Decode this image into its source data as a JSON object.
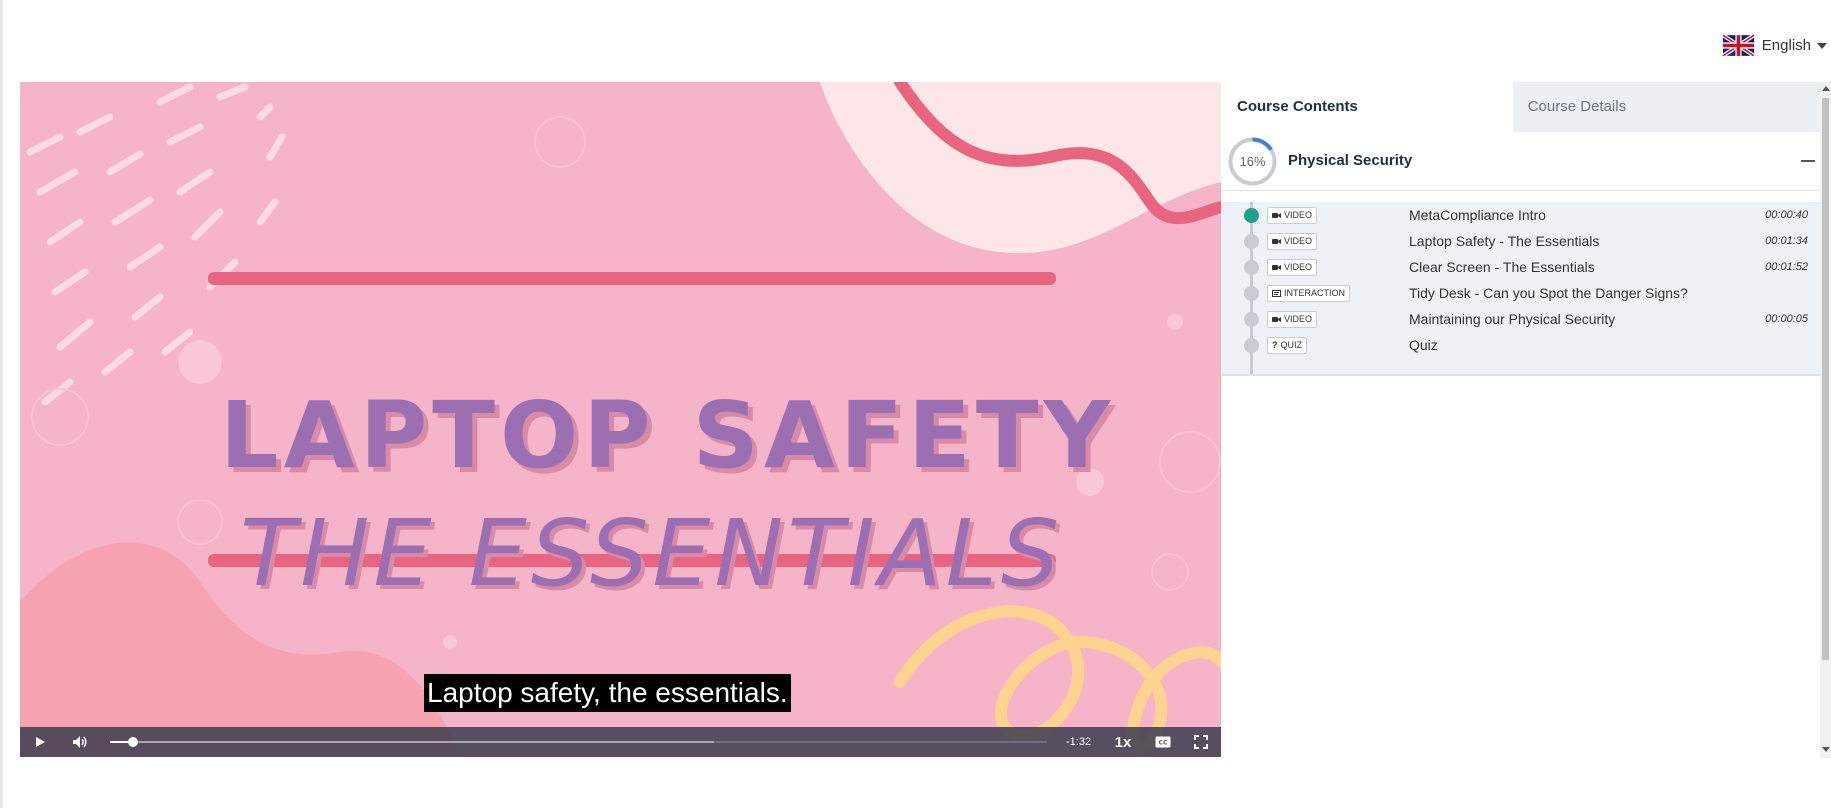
{
  "language": {
    "label": "English",
    "flag_icon": "uk-flag-icon"
  },
  "video": {
    "slide_title_line1": "LAPTOP SAFETY",
    "slide_title_line2": "THE ESSENTIALS",
    "subtitle": "Laptop safety, the essentials.",
    "controls": {
      "play_icon": "play-icon",
      "volume_icon": "volume-icon",
      "played_fraction": 0.025,
      "buffered_fraction": 0.645,
      "time_remaining": "-1:32",
      "speed": "1x",
      "captions_icon": "captions-icon",
      "fullscreen_icon": "fullscreen-icon"
    }
  },
  "panel": {
    "tabs": [
      {
        "label": "Course Contents",
        "active": true
      },
      {
        "label": "Course Details",
        "active": false
      }
    ],
    "section": {
      "progress_label": "16%",
      "progress_value": 16,
      "title": "Physical Security"
    },
    "lessons": [
      {
        "type": "VIDEO",
        "icon": "video-camera-icon",
        "title": "MetaCompliance Intro",
        "duration": "00:00:40",
        "current": true
      },
      {
        "type": "VIDEO",
        "icon": "video-camera-icon",
        "title": "Laptop Safety - The Essentials",
        "duration": "00:01:34",
        "current": false
      },
      {
        "type": "VIDEO",
        "icon": "video-camera-icon",
        "title": "Clear Screen - The Essentials",
        "duration": "00:01:52",
        "current": false
      },
      {
        "type": "INTERACTION",
        "icon": "interaction-icon",
        "title": "Tidy Desk - Can you Spot the Danger Signs?",
        "duration": "",
        "current": false
      },
      {
        "type": "VIDEO",
        "icon": "video-camera-icon",
        "title": "Maintaining our Physical Security",
        "duration": "00:00:05",
        "current": false
      },
      {
        "type": "QUIZ",
        "icon": "question-icon",
        "title": "Quiz",
        "duration": "",
        "current": false
      }
    ]
  },
  "colors": {
    "slide_background": "#f5b4c8",
    "title_purple": "#9b6fb2",
    "stripe_red": "#e86480",
    "current_lesson_green": "#1aa389",
    "progress_blue": "#3b82d6"
  }
}
